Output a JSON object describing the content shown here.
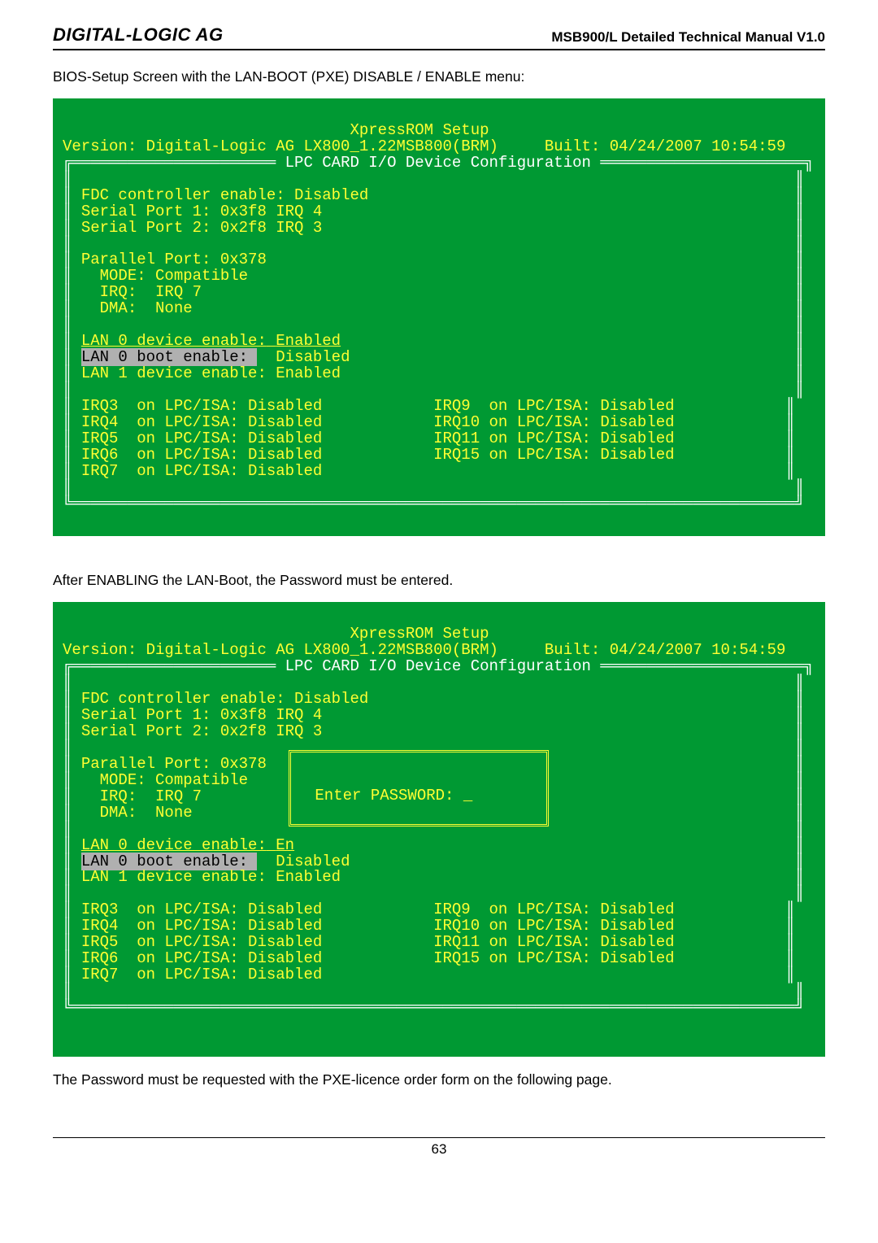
{
  "header": {
    "left": "DIGITAL-LOGIC AG",
    "right": "MSB900/L Detailed Technical Manual V1.0"
  },
  "intro1": "BIOS-Setup Screen with the LAN-BOOT (PXE) DISABLE / ENABLE menu:",
  "intro2": "After ENABLING the LAN-Boot, the Password must be entered.",
  "outro": "The Password must be requested with the PXE-licence order form on the following page.",
  "page_number": "63",
  "bios": {
    "setup_title": "XpressROM Setup",
    "version_line_left": "Version: Digital-Logic AG LX800_1.22MSB800(BRM)",
    "version_line_right": "Built: 04/24/2007 10:54:59",
    "box_title": " LPC CARD I/O Device Configuration ",
    "fdc": "FDC controller enable: Disabled",
    "sp1": "Serial Port 1: 0x3f8 IRQ 4",
    "sp2": "Serial Port 2: 0x2f8 IRQ 3",
    "pp_addr": "Parallel Port: 0x378",
    "pp_mode": "  MODE: Compatible",
    "pp_irq": "  IRQ:  IRQ 7",
    "pp_dma": "  DMA:  None",
    "lan0dev_label": "LAN 0 device enable:",
    "lan0dev_val_enabled": "Enabled",
    "lan0dev_val_en": "En",
    "lan0boot_label": "LAN 0 boot enable:",
    "lan0boot_val": "Disabled",
    "lan1dev": "LAN 1 device enable: Enabled",
    "irq_left": [
      "IRQ3  on LPC/ISA: Disabled",
      "IRQ4  on LPC/ISA: Disabled",
      "IRQ5  on LPC/ISA: Disabled",
      "IRQ6  on LPC/ISA: Disabled",
      "IRQ7  on LPC/ISA: Disabled"
    ],
    "irq_right": [
      "IRQ9  on LPC/ISA: Disabled",
      "IRQ10 on LPC/ISA: Disabled",
      "IRQ11 on LPC/ISA: Disabled",
      "IRQ15 on LPC/ISA: Disabled"
    ],
    "password_prompt": "Enter PASSWORD: _"
  }
}
